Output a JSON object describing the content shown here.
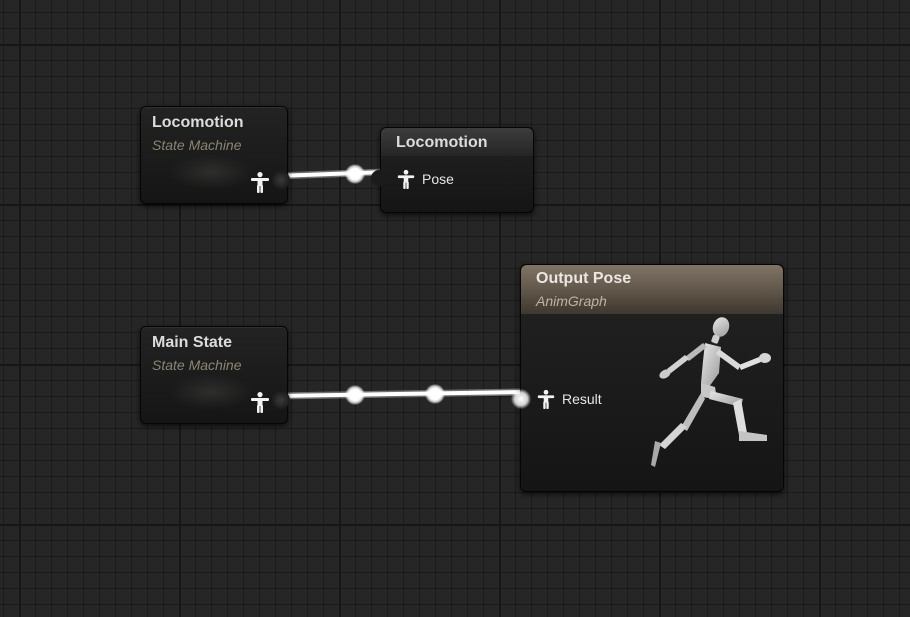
{
  "graph": {
    "name": "AnimGraph"
  },
  "nodes": {
    "locomotion_state_machine": {
      "title": "Locomotion",
      "subtitle": "State Machine",
      "output_pin_icon": "pose-icon"
    },
    "main_state_machine": {
      "title": "Main State",
      "subtitle": "State Machine",
      "output_pin_icon": "pose-icon"
    },
    "locomotion_ref": {
      "title": "Locomotion",
      "input_pin": {
        "label": "Pose",
        "icon": "pose-icon"
      }
    },
    "output_pose": {
      "title": "Output Pose",
      "subtitle": "AnimGraph",
      "input_pin": {
        "label": "Result",
        "icon": "pose-icon"
      },
      "preview_icon": "running-mannequin-icon"
    }
  },
  "colors": {
    "background": "#262626",
    "grid_major": "#161616",
    "wire": "#ffffff",
    "output_header": "#807466",
    "subtitle": "#8a8574"
  }
}
